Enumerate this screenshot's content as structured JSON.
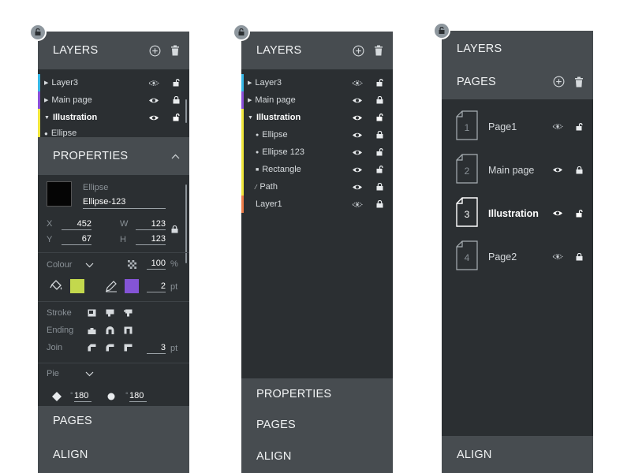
{
  "panel1": {
    "layers_title": "LAYERS",
    "layers": [
      {
        "label": "Layer3",
        "bold": false
      },
      {
        "label": "Main page",
        "bold": false
      },
      {
        "label": "Illustration",
        "bold": true
      },
      {
        "label": "Ellipse",
        "bold": false
      }
    ],
    "properties_title": "PROPERTIES",
    "object_type": "Ellipse",
    "object_name": "Ellipse-123",
    "x_label": "X",
    "x_value": "452",
    "y_label": "Y",
    "y_value": "67",
    "w_label": "W",
    "w_value": "123",
    "h_label": "H",
    "h_value": "123",
    "colour_label": "Colour",
    "opacity_value": "100",
    "opacity_unit": "%",
    "stroke_width": "2",
    "stroke_unit": "pt",
    "stroke_label": "Stroke",
    "ending_label": "Ending",
    "join_label": "Join",
    "join_value": "3",
    "join_unit": "pt",
    "pie_label": "Pie",
    "angle1": "180",
    "angle2": "180",
    "degree_mark": "°",
    "pages_title": "PAGES",
    "align_title": "ALIGN",
    "fill_color": "#c3d84d",
    "stroke_color": "#8454d6"
  },
  "panel2": {
    "layers_title": "LAYERS",
    "layers": [
      {
        "label": "Layer3",
        "bold": false
      },
      {
        "label": "Main page",
        "bold": false
      },
      {
        "label": "Illustration",
        "bold": true
      },
      {
        "label": "Ellipse",
        "bold": false
      },
      {
        "label": "Ellipse 123",
        "bold": false
      },
      {
        "label": "Rectangle",
        "bold": false
      },
      {
        "label": "Path",
        "bold": false
      },
      {
        "label": "Layer1",
        "bold": false
      }
    ],
    "properties_title": "PROPERTIES",
    "pages_title": "PAGES",
    "align_title": "ALIGN"
  },
  "panel3": {
    "layers_title": "LAYERS",
    "pages_title": "PAGES",
    "pages": [
      {
        "num": "1",
        "name": "Page1"
      },
      {
        "num": "2",
        "name": "Main page"
      },
      {
        "num": "3",
        "name": "Illustration"
      },
      {
        "num": "4",
        "name": "Page2"
      }
    ],
    "align_title": "ALIGN"
  },
  "colors": {
    "layer3": "#35b7e6",
    "main_page": "#8a4fd8",
    "illustration": "#f1e73c",
    "layer1": "#ee7c48",
    "panel_bg": "#2b2f32",
    "header_bg": "#474c50"
  },
  "icons": [
    "pin-lock-icon",
    "add-circle-icon",
    "trash-icon",
    "eye-icon",
    "eye-hidden-icon",
    "lock-icon",
    "unlock-icon",
    "chevron-up-icon",
    "chevron-down-icon",
    "checker-icon",
    "paint-bucket-icon",
    "pen-icon",
    "diamond-icon",
    "circle-icon",
    "document-icon"
  ]
}
